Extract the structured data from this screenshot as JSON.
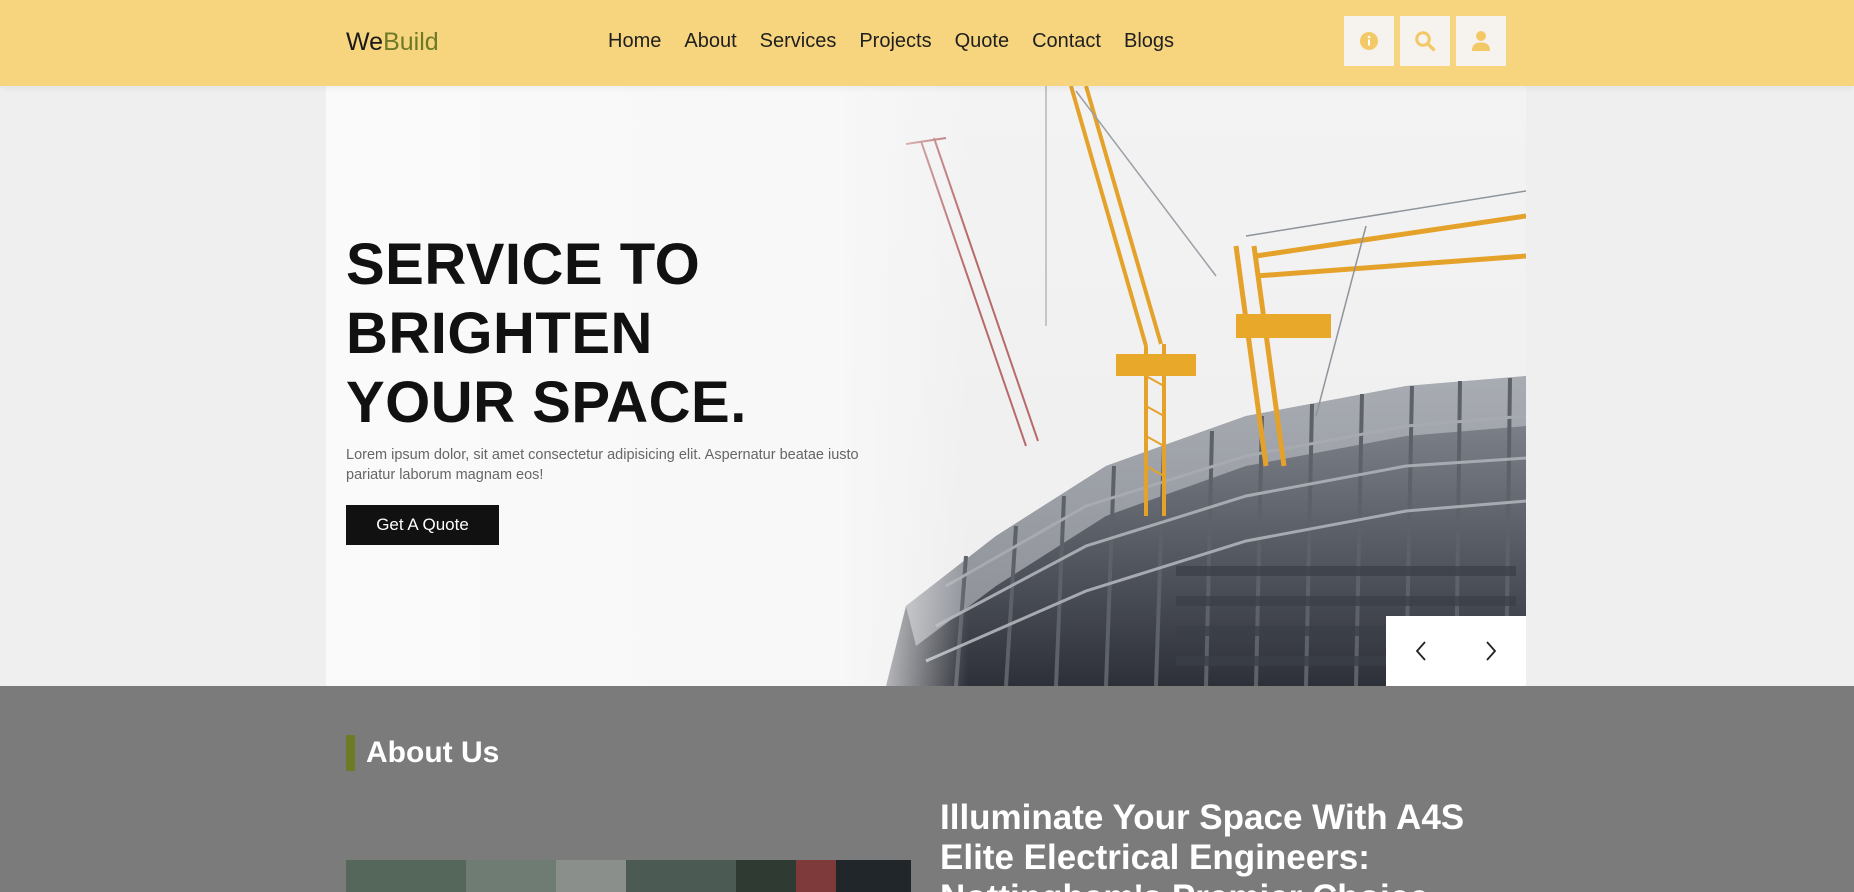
{
  "brand": {
    "logo_part1": "We",
    "logo_part2": "Build",
    "accent_color": "#6f7a27",
    "header_color": "#f7d57e"
  },
  "nav": {
    "items": [
      {
        "label": "Home"
      },
      {
        "label": "About"
      },
      {
        "label": "Services"
      },
      {
        "label": "Projects"
      },
      {
        "label": "Quote"
      },
      {
        "label": "Contact"
      },
      {
        "label": "Blogs"
      }
    ]
  },
  "header_icons": [
    "info-icon",
    "search-icon",
    "user-icon"
  ],
  "hero": {
    "title_lines": [
      "SERVICE TO",
      "BRIGHTEN",
      "YOUR SPACE."
    ],
    "description": "Lorem ipsum dolor, sit amet consectetur adipisicing elit. Aspernatur beatae iusto pariatur laborum magnam eos!",
    "cta_label": "Get A Quote",
    "slider_controls": [
      "previous-arrow-icon",
      "next-arrow-icon"
    ]
  },
  "about": {
    "section_title": "About Us",
    "heading": "Illuminate Your Space With A4S Elite Electrical Engineers: Nottingham's Premier Choice"
  }
}
